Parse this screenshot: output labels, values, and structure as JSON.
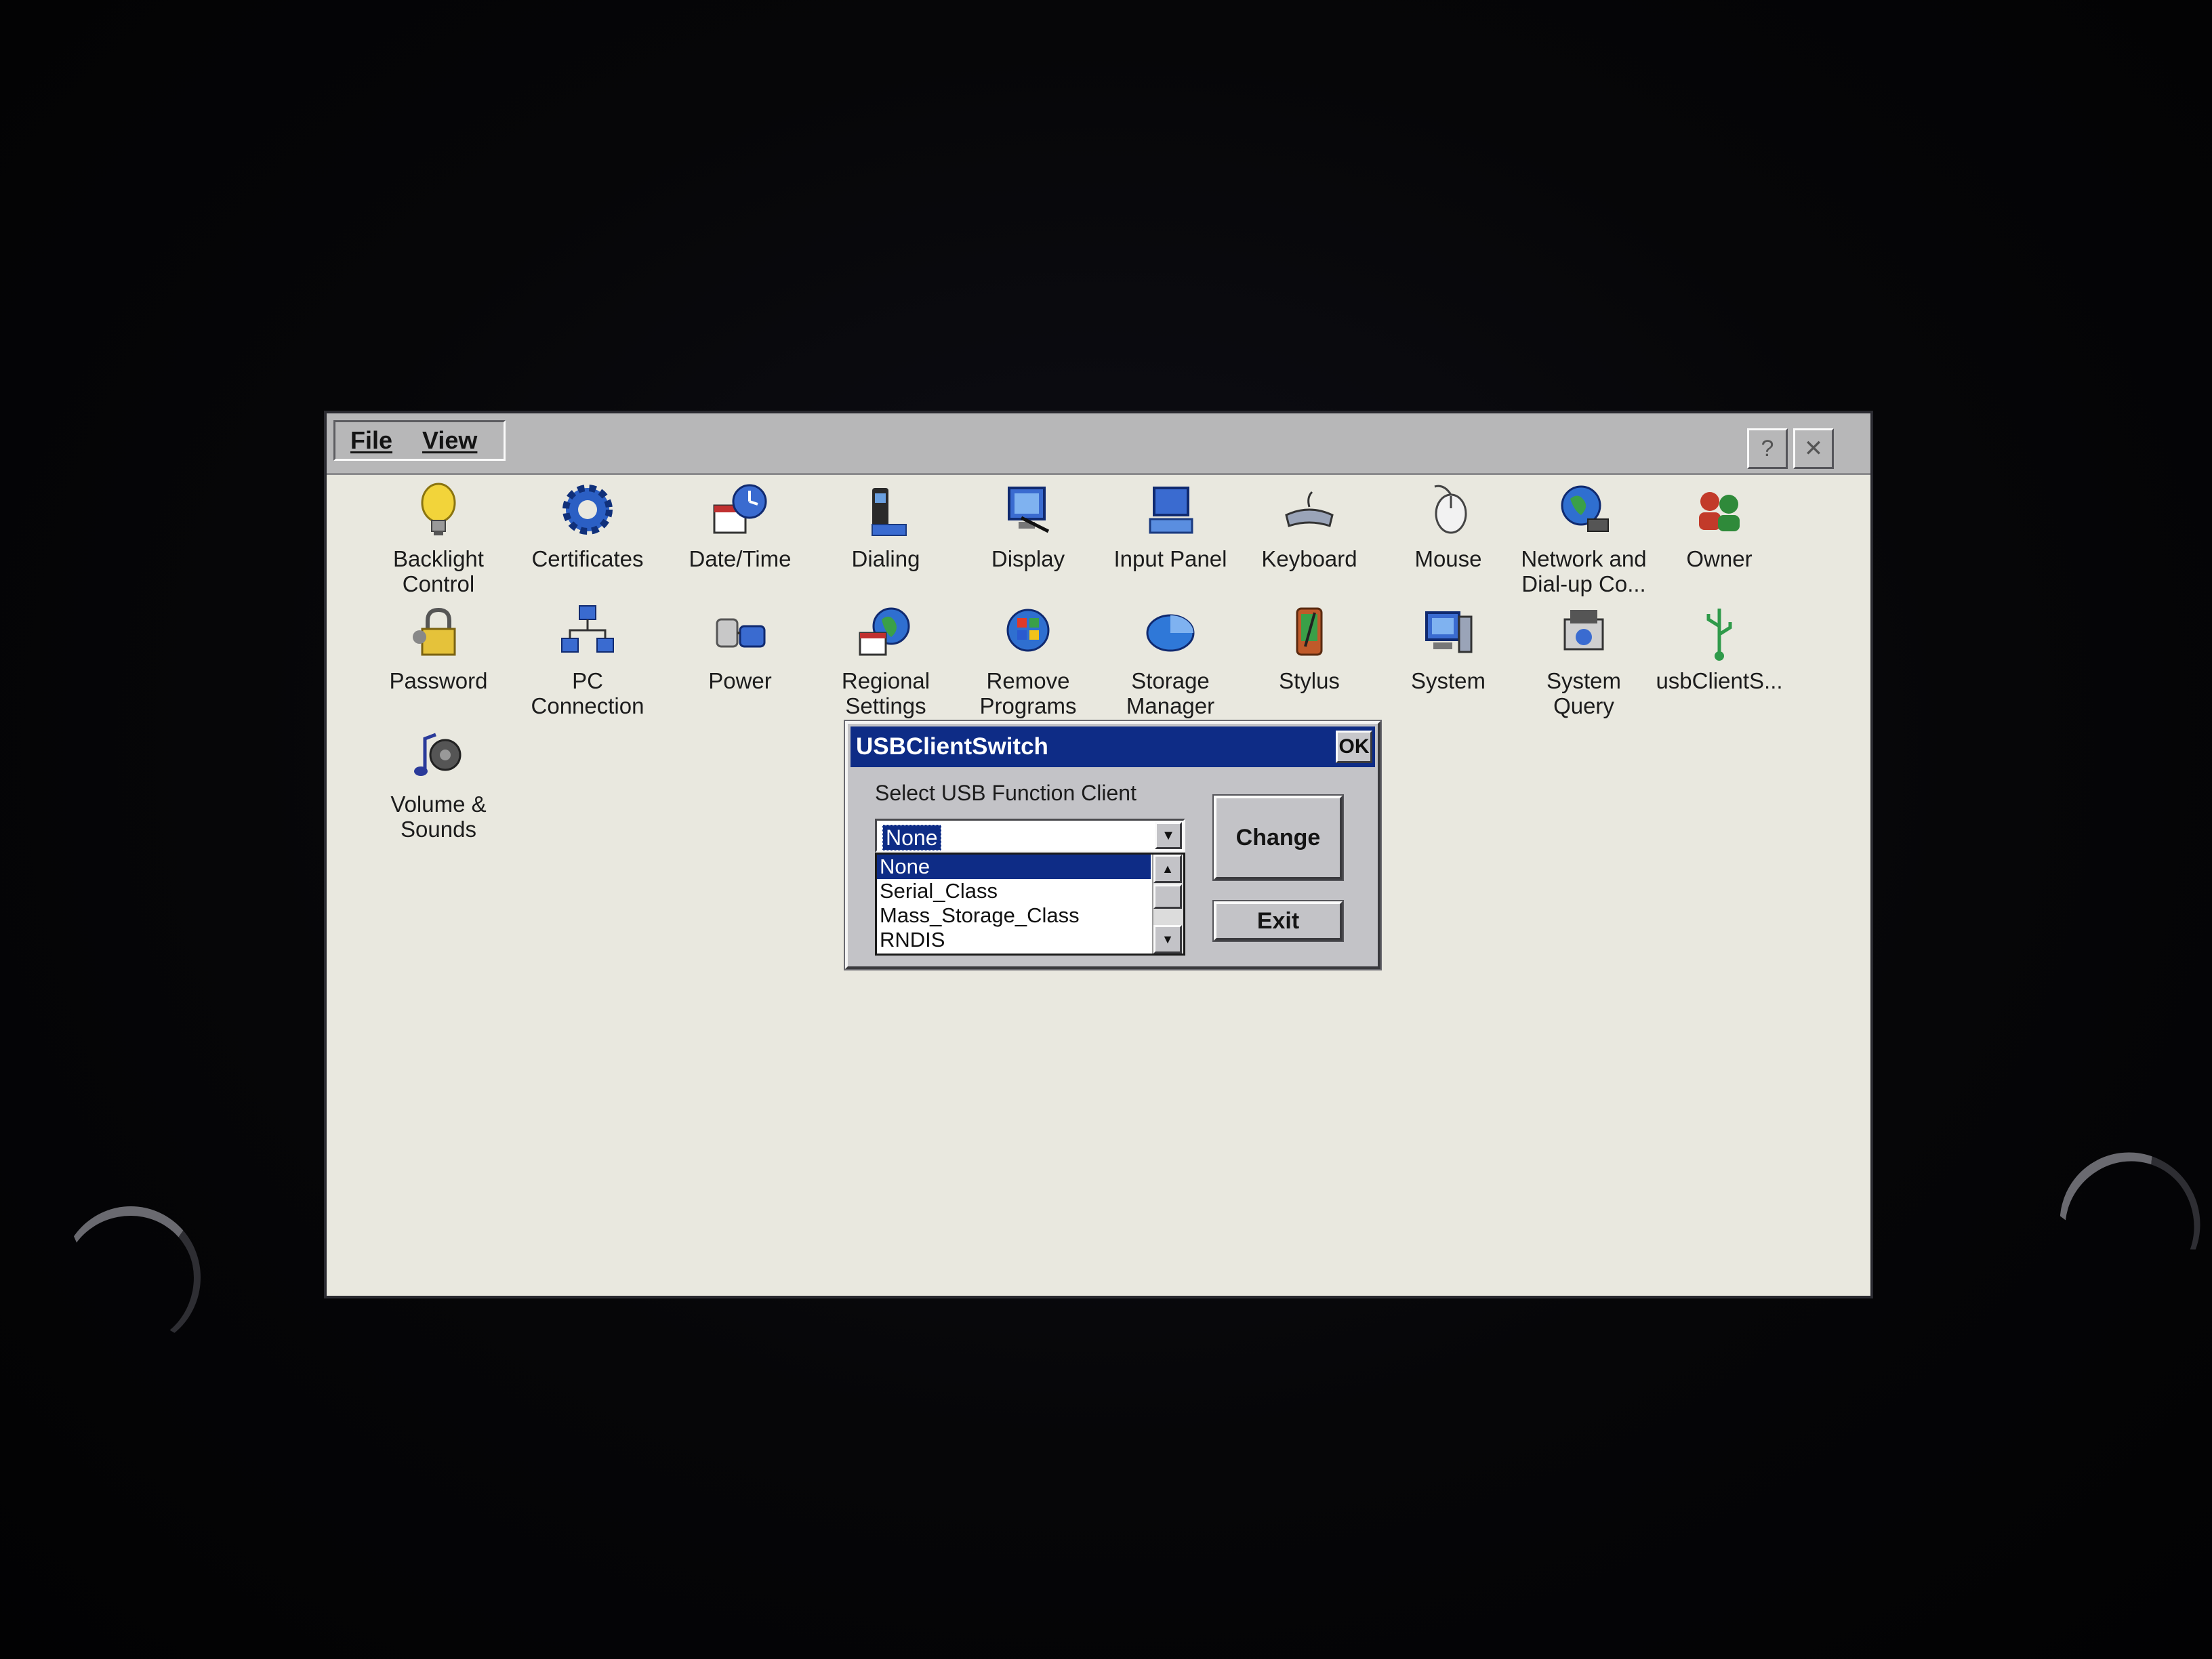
{
  "menu": {
    "file": "File",
    "view": "View"
  },
  "window_buttons": {
    "help": "?",
    "close": "✕"
  },
  "icons": [
    {
      "label": "Backlight\nControl",
      "icon": "lightbulb-icon"
    },
    {
      "label": "Certificates",
      "icon": "gear-icon"
    },
    {
      "label": "Date/Time",
      "icon": "calendar-clock-icon"
    },
    {
      "label": "Dialing",
      "icon": "phone-icon"
    },
    {
      "label": "Display",
      "icon": "monitor-icon"
    },
    {
      "label": "Input Panel",
      "icon": "keyboard-monitor-icon"
    },
    {
      "label": "Keyboard",
      "icon": "keyboard-icon"
    },
    {
      "label": "Mouse",
      "icon": "mouse-icon"
    },
    {
      "label": "Network and\nDial-up Co...",
      "icon": "globe-network-icon"
    },
    {
      "label": "Owner",
      "icon": "people-icon"
    },
    {
      "label": "Password",
      "icon": "padlock-icon"
    },
    {
      "label": "PC\nConnection",
      "icon": "pc-connection-icon"
    },
    {
      "label": "Power",
      "icon": "power-icon"
    },
    {
      "label": "Regional\nSettings",
      "icon": "globe-calendar-icon"
    },
    {
      "label": "Remove\nPrograms",
      "icon": "windows-flag-icon"
    },
    {
      "label": "Storage\nManager",
      "icon": "pie-disk-icon"
    },
    {
      "label": "Stylus",
      "icon": "stylus-icon"
    },
    {
      "label": "System",
      "icon": "system-computer-icon"
    },
    {
      "label": "System\nQuery",
      "icon": "system-query-icon"
    },
    {
      "label": "usbClientS...",
      "icon": "usb-icon"
    },
    {
      "label": "Volume &\nSounds",
      "icon": "speaker-note-icon"
    }
  ],
  "dialog": {
    "title": "USBClientSwitch",
    "ok_label": "OK",
    "prompt": "Select USB Function Client",
    "selected_value": "None",
    "options": [
      "None",
      "Serial_Class",
      "Mass_Storage_Class",
      "RNDIS"
    ],
    "change_label": "Change",
    "exit_label": "Exit"
  },
  "colors": {
    "title_bar": "#0e2c86",
    "desktop_bg": "#e9e8df",
    "dialog_bg": "#c3c3c7"
  }
}
